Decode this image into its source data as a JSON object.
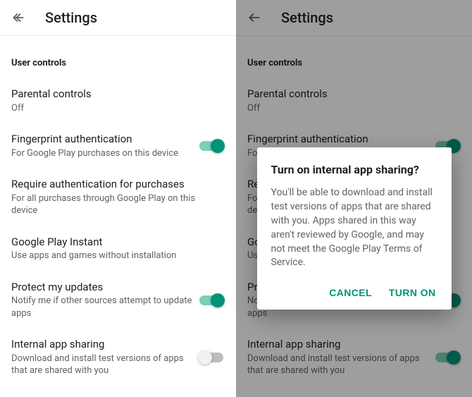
{
  "appbar": {
    "title": "Settings"
  },
  "section": {
    "header": "User controls"
  },
  "settings": {
    "parental": {
      "title": "Parental controls",
      "sub": "Off"
    },
    "fingerprint": {
      "title": "Fingerprint authentication",
      "sub": "For Google Play purchases on this device"
    },
    "requireAuth": {
      "title": "Require authentication for purchases",
      "sub": "For all purchases through Google Play on this device"
    },
    "instant": {
      "title": "Google Play Instant",
      "sub": "Use apps and games without installation"
    },
    "protect": {
      "title": "Protect my updates",
      "sub": "Notify me if other sources attempt to update apps"
    },
    "internal": {
      "title": "Internal app sharing",
      "sub": "Download and install test versions of apps that are shared with you"
    }
  },
  "toggles": {
    "left": {
      "fingerprint": true,
      "protect": true,
      "internal": false
    },
    "right": {
      "fingerprint": true,
      "protect": true,
      "internal": true
    }
  },
  "dialog": {
    "title": "Turn on internal app sharing?",
    "body": "You'll be able to download and install test versions of apps that are shared with you. Apps shared in this way aren't reviewed by Google, and may not meet the Google Play Terms of Service.",
    "cancel": "CANCEL",
    "confirm": "TURN ON"
  },
  "colors": {
    "accent": "#009378"
  }
}
